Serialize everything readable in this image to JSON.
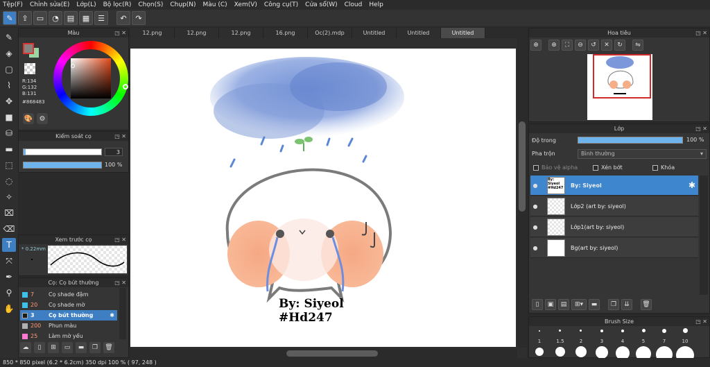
{
  "menu": [
    "Tệp(F)",
    "Chỉnh sửa(E)",
    "Lớp(L)",
    "Bộ lọc(R)",
    "Chọn(S)",
    "Chụp(N)",
    "Màu (C)",
    "Xem(V)",
    "Công cụ(T)",
    "Cửa sổ(W)",
    "Cloud",
    "Help"
  ],
  "panels": {
    "color_title": "Màu",
    "brush_control_title": "Kiểm soát cọ",
    "brush_preview_title": "Xem trước cọ",
    "brush_list_title": "Cọ: Cọ bút thường",
    "navigator_title": "Hoa tiêu",
    "layers_title": "Lớp",
    "brush_size_title": "Brush Size"
  },
  "color": {
    "r": "R:134",
    "g": "G:132",
    "b": "B:131",
    "hex": "#868483"
  },
  "brush_control": {
    "size": "3",
    "opacity": "100 %"
  },
  "brush_preview": {
    "size": "0.22mm"
  },
  "brush_list": [
    {
      "num": "7",
      "name": "Cọ shade đậm",
      "color": "#3fc0e6"
    },
    {
      "num": "20",
      "name": "Cọ shade mờ",
      "color": "#3fc0e6"
    },
    {
      "num": "3",
      "name": "Cọ bút thường",
      "color": "#1a1a1a"
    },
    {
      "num": "200",
      "name": "Phun màu",
      "color": "#b0b0b0"
    },
    {
      "num": "25",
      "name": "Làm mờ yếu",
      "color": "#ff7ad0"
    }
  ],
  "tabs": [
    "12.png",
    "12.png",
    "12.png",
    "16.png",
    "Oc(2).mdp",
    "Untitled",
    "Untitled",
    "Untitled"
  ],
  "artwork": {
    "signature_line1": "By: Siyeol",
    "signature_line2": "#Hd247"
  },
  "layers": {
    "opacity_label": "Độ trong",
    "opacity_value": "100 %",
    "blend_label": "Pha trộn",
    "blend_value": "Bình thường",
    "protect_alpha": "Bảo vệ alpha",
    "clipping": "Xén bớt",
    "lock": "Khóa",
    "items": [
      {
        "name": "By: Siyeol",
        "thumb": "By: Siyeol #Hd247"
      },
      {
        "name": "Lớp2 (art by: siyeol)",
        "thumb": ""
      },
      {
        "name": "Lớp1(art by: siyeol)",
        "thumb": ""
      },
      {
        "name": "Bg(art by: siyeol)",
        "thumb": ""
      }
    ]
  },
  "brush_sizes": [
    "1",
    "1.5",
    "2",
    "3",
    "4",
    "5",
    "7",
    "10"
  ],
  "status": "850 * 850 pixel   (6.2 * 6.2cm)   350 dpi   100 %   ( 97, 248 )"
}
